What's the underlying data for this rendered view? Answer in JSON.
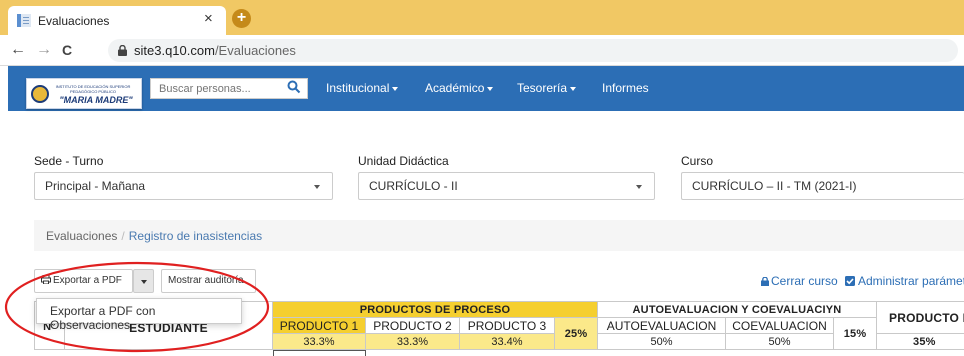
{
  "browser": {
    "tab_title": "Evaluaciones",
    "tab_close": "×",
    "new_tab": "+",
    "url_host": "site3.q10.com",
    "url_path": "/Evaluaciones",
    "back": "←",
    "forward": "→",
    "reload": "C"
  },
  "navbar": {
    "logo_small": "INSTITUTO DE EDUCACIÓN SUPERIOR PEDAGÓGICO PÚBLICO",
    "logo_main": "\"MARIA MADRE\"",
    "search_placeholder": "Buscar personas...",
    "menu": [
      "Institucional",
      "Académico",
      "Tesorería",
      "Informes"
    ]
  },
  "filters": {
    "sede_label": "Sede - Turno",
    "sede_value": "Principal - Mañana",
    "unidad_label": "Unidad Didáctica",
    "unidad_value": "CURRÍCULO - II",
    "curso_label": "Curso",
    "curso_value": "CURRÍCULO – II - TM (2021-I)"
  },
  "breadcrumb": {
    "root": "Evaluaciones",
    "sep": "/",
    "current": "Registro de inasistencias"
  },
  "toolbar": {
    "export_pdf": "Exportar a PDF",
    "mostrar_auditoria": "Mostrar auditoría",
    "dropdown_item": "Exportar a PDF con Observaciones",
    "cerrar_curso": "Cerrar curso",
    "administrar": "Administrar parámetros"
  },
  "table": {
    "col_n": "N°",
    "col_estudiante": "ESTUDIANTE",
    "group1": "PRODUCTOS DE PROCESO",
    "group1_items": [
      {
        "name": "PRODUCTO 1",
        "weight": "33.3%"
      },
      {
        "name": "PRODUCTO 2",
        "weight": "33.3%"
      },
      {
        "name": "PRODUCTO 3",
        "weight": "33.4%"
      }
    ],
    "group1_weight": "25%",
    "group2": "AUTOEVALUACION Y COEVALUACIYN",
    "group2_items": [
      {
        "name": "AUTOEVALUACION",
        "weight": "50%"
      },
      {
        "name": "COEVALUACION",
        "weight": "50%"
      }
    ],
    "group2_weight": "15%",
    "group3": "PRODUCTO FINAL",
    "group3_weight": "35%"
  },
  "colors": {
    "navbar": "#2c6eb5",
    "tabstrip": "#f1c864",
    "header_yellow": "#f5cf2f",
    "annotation": "#e02020"
  }
}
